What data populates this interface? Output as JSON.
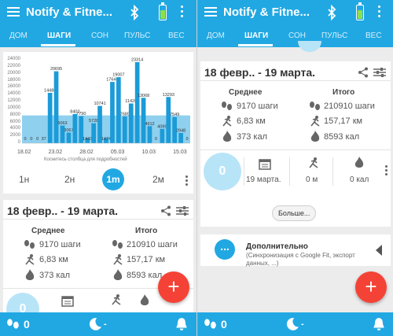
{
  "app": {
    "title": "Notify & Fitne..."
  },
  "tabs": [
    "ДОМ",
    "ШАГИ",
    "СОН",
    "ПУЛЬС",
    "ВЕС"
  ],
  "tabs_right": [
    "ДОМ",
    "ШАГИ",
    "СОН",
    "ПУЛЬС",
    "ВЕС"
  ],
  "active_tab": "ШАГИ",
  "icons": {
    "menu": "hamburger-icon",
    "bluetooth": "bluetooth-icon",
    "battery": "battery-icon",
    "overflow": "vertical-dots-icon",
    "share": "share-icon",
    "settings": "sliders-icon",
    "steps": "footprints-icon",
    "distance": "runner-icon",
    "calories": "flame-icon",
    "calendar": "calendar-icon",
    "sleep": "moon-icon",
    "alarm": "bell-icon",
    "add": "plus-icon"
  },
  "colors": {
    "primary": "#21a8e3",
    "accent": "#f44336",
    "bar_dark": "#1b9bd8",
    "bar_light": "#8fd0ef"
  },
  "chart_data": {
    "type": "bar",
    "title": "",
    "xlabel": "Коснитесь столбца для подробностей",
    "ylabel": "",
    "ylim": [
      0,
      24000
    ],
    "yticks": [
      "0",
      "2000",
      "4000",
      "6000",
      "8000",
      "10000",
      "12000",
      "14000",
      "16000",
      "18000",
      "20000",
      "22000",
      "24000"
    ],
    "xticks": [
      "18.02",
      "23.02",
      "28.02",
      "05.03",
      "10.03",
      "15.03"
    ],
    "average_line": 8000,
    "values": [
      0,
      0,
      0,
      37,
      14486,
      20695,
      5063,
      3067,
      8402,
      7790,
      1443,
      5728,
      10741,
      1474,
      17646,
      19007,
      7689,
      11426,
      23314,
      13068,
      4912,
      0,
      4095,
      13293,
      7549,
      2948,
      0
    ],
    "labels": [
      "0",
      "0",
      "0",
      "37",
      "14486",
      "20695",
      "5063",
      "3067",
      "8402",
      "7790",
      "1443",
      "5728",
      "10741",
      "1474",
      "17646",
      "19007",
      "7689",
      "11426",
      "23314",
      "13068",
      "4912",
      "0",
      "4095",
      "13293",
      "7549",
      "2948",
      "0"
    ]
  },
  "chart_hint": "Коснитесь столбца для подробностей",
  "zoom": [
    "1н",
    "2н",
    "1m",
    "2м"
  ],
  "zoom_active": "1m",
  "summary": {
    "period": "18 февр.. - 19 марта.",
    "avg_label": "Среднее",
    "total_label": "Итого",
    "avg_steps": "9170 шаги",
    "avg_km": "6,83 км",
    "avg_cal": "373 кал",
    "total_steps": "210910 шаги",
    "total_km": "157,17 км",
    "total_cal": "8593 кал"
  },
  "today": {
    "steps": "0",
    "date": "19 марта.",
    "distance": "0 м",
    "calories": "0 кал"
  },
  "more_button": "Больше...",
  "additional": {
    "title": "Дополнительно",
    "subtitle": "(Синхронизация с Google Fit, экспорт данных, ...)",
    "icon": "..."
  },
  "fab": "+",
  "bottom": {
    "steps": "0",
    "sleep": "-"
  }
}
